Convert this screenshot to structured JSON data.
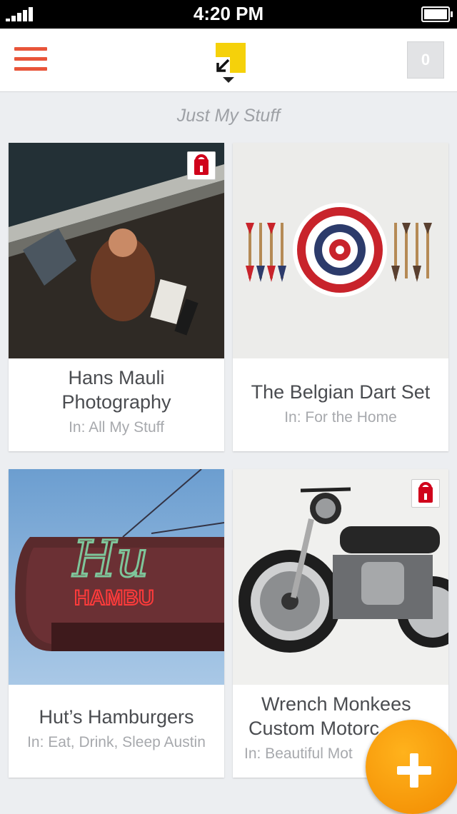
{
  "status_bar": {
    "time": "4:20 PM"
  },
  "header": {
    "cart_count": "0"
  },
  "section": {
    "title": "Just My Stuff"
  },
  "cards": [
    {
      "title_line1": "Hans Mauli",
      "title_line2": "Photography",
      "collection": "In: All My Stuff",
      "locked": true,
      "image": "couple-on-wall-photo"
    },
    {
      "title_line1": "The Belgian Dart Set",
      "collection": "In: For the Home",
      "locked": false,
      "image": "dartboard-photo"
    },
    {
      "title_line1": "Hut’s Hamburgers",
      "collection": "In: Eat, Drink, Sleep Austin",
      "locked": false,
      "image": "neon-sign-photo"
    },
    {
      "title_line1": "Wrench Monkees",
      "title_line2": "Custom Motorc",
      "collection": "In: Beautiful Mot",
      "locked": true,
      "image": "motorcycle-photo"
    }
  ],
  "fab": {
    "icon": "plus-icon"
  },
  "colors": {
    "accent": "#e8553a",
    "fab": "#f7a00c",
    "logo_yellow": "#f5d10a",
    "lock_red": "#d0021b"
  }
}
